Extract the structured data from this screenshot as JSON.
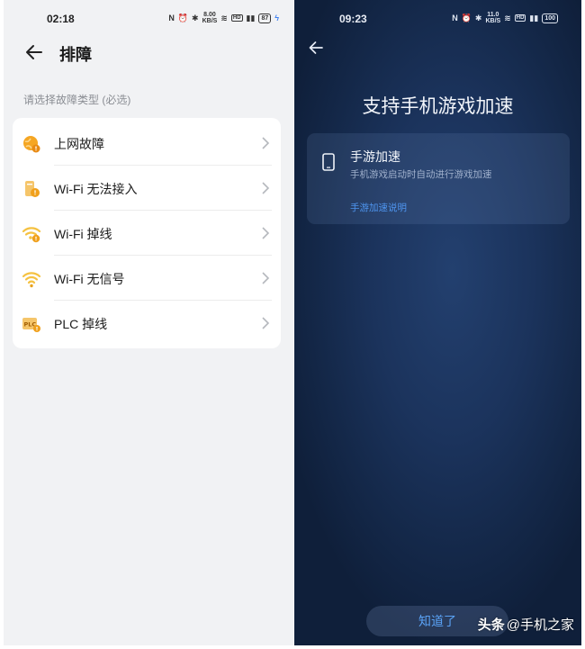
{
  "left_screen": {
    "status": {
      "time": "02:18",
      "net_speed": "8.00",
      "net_unit": "KB/S",
      "battery": "87"
    },
    "header": {
      "title": "排障"
    },
    "section_label": "请选择故障类型 (必选)",
    "items": [
      {
        "label": "上网故障",
        "icon": "globe-warning-icon"
      },
      {
        "label": "Wi-Fi 无法接入",
        "icon": "router-warning-icon"
      },
      {
        "label": "Wi-Fi 掉线",
        "icon": "wifi-warning-icon"
      },
      {
        "label": "Wi-Fi 无信号",
        "icon": "wifi-weak-icon"
      },
      {
        "label": "PLC 掉线",
        "icon": "plc-icon",
        "icon_text": "PLC"
      }
    ]
  },
  "right_screen": {
    "status": {
      "time": "09:23",
      "net_speed": "11.0",
      "net_unit": "KB/S",
      "battery": "100"
    },
    "title": "支持手机游戏加速",
    "feature": {
      "title": "手游加速",
      "description": "手机游戏启动时自动进行游戏加速",
      "link": "手游加速说明"
    },
    "confirm_button": "知道了"
  },
  "watermark": {
    "brand": "头条",
    "handle": "@手机之家"
  },
  "colors": {
    "accent_orange": "#f5a623",
    "link_blue": "#4e95ef",
    "dark_bg": "#142849"
  }
}
